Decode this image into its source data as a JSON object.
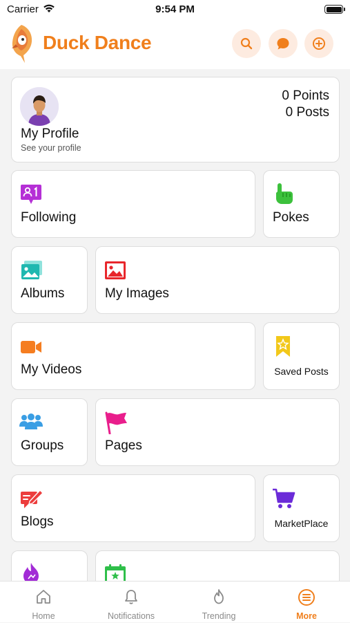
{
  "status_bar": {
    "carrier": "Carrier",
    "time": "9:54 PM"
  },
  "header": {
    "title": "Duck Dance"
  },
  "profile": {
    "name": "My Profile",
    "subtitle": "See your profile",
    "points": "0 Points",
    "posts": "0 Posts"
  },
  "menu": {
    "following": "Following",
    "pokes": "Pokes",
    "albums": "Albums",
    "my_images": "My Images",
    "my_videos": "My Videos",
    "saved_posts": "Saved Posts",
    "groups": "Groups",
    "pages": "Pages",
    "blogs": "Blogs",
    "marketplace": "MarketPlace"
  },
  "tabs": [
    {
      "label": "Home",
      "icon": "home-icon"
    },
    {
      "label": "Notifications",
      "icon": "bell-icon"
    },
    {
      "label": "Trending",
      "icon": "flame-icon"
    },
    {
      "label": "More",
      "icon": "menu-icon",
      "active": true
    }
  ],
  "colors": {
    "accent": "#f07f1c",
    "following": "#b52fd6",
    "pokes": "#3cc13c",
    "albums": "#1fb8b0",
    "my_images": "#e8262b",
    "my_videos": "#f57d20",
    "saved_posts": "#f2c81a",
    "groups": "#3a9ee4",
    "pages": "#e91e8c",
    "blogs": "#ec3d3d",
    "marketplace": "#6b2bd8"
  }
}
